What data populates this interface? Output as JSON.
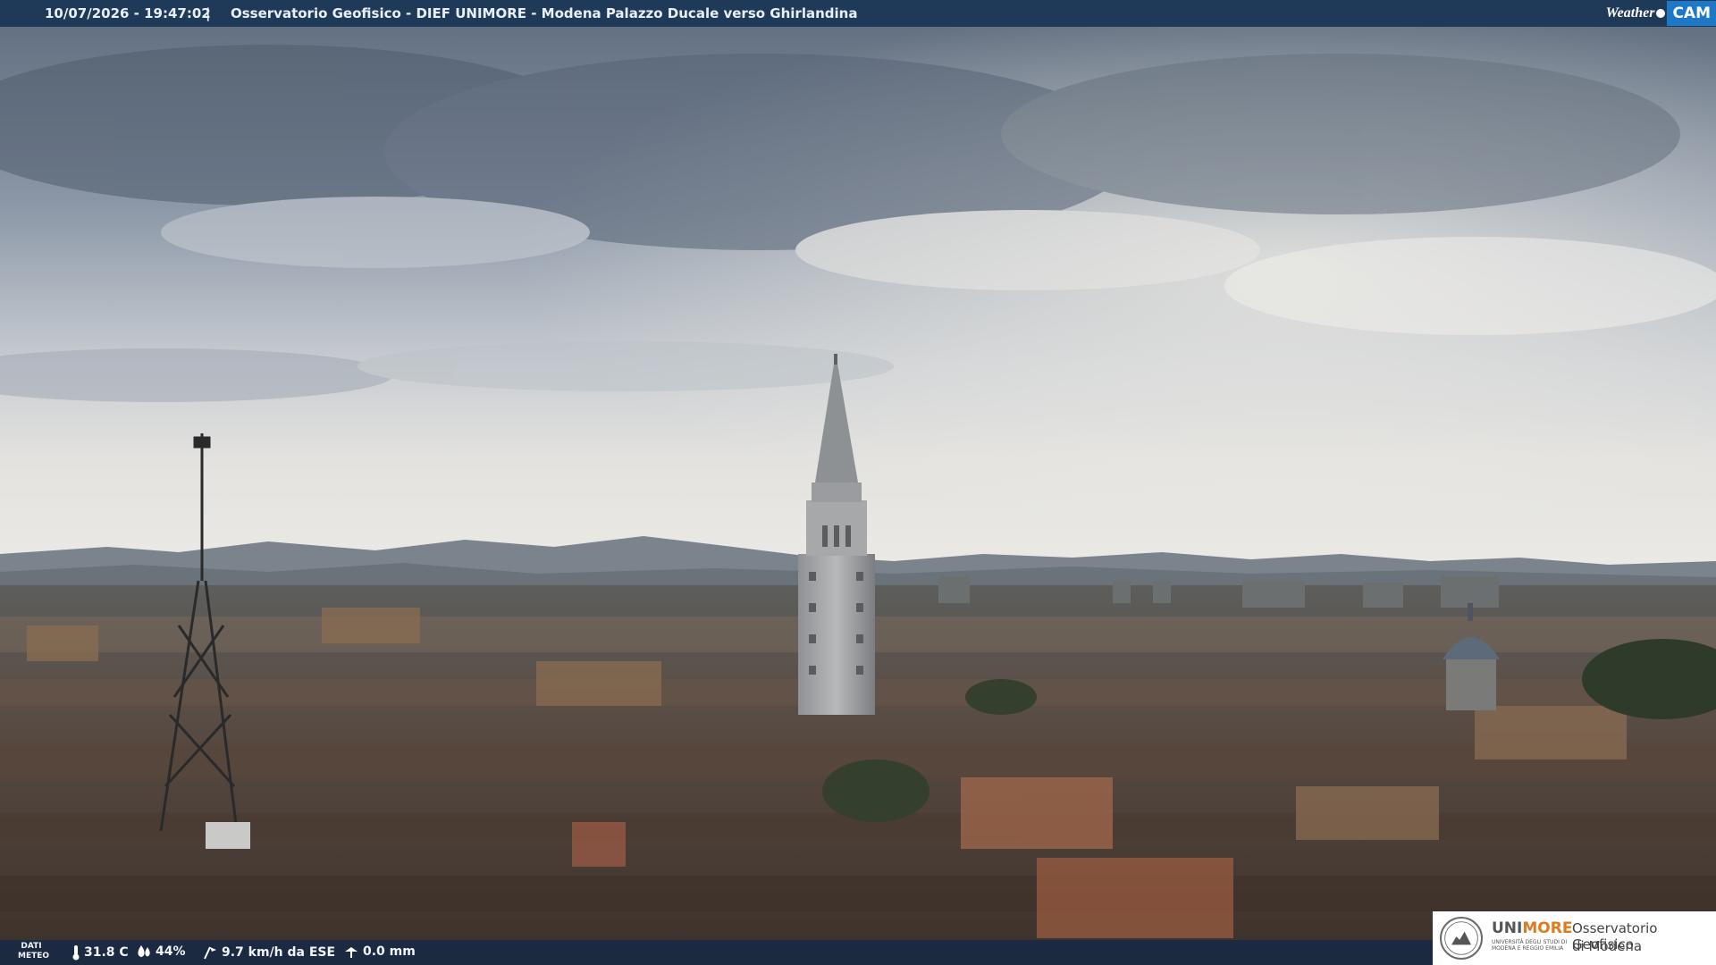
{
  "overlay": {
    "timestamp": "10/07/2026 - 19:47:02",
    "separator": "|",
    "camera_title": "Osservatorio Geofisico - DIEF UNIMORE - Modena Palazzo Ducale verso Ghirlandina",
    "brand_weather": "Weather",
    "brand_cam": "CAM"
  },
  "meteo": {
    "label_line1": "DATI",
    "label_line2": "METEO",
    "temperature": "31.8 C",
    "humidity": "44%",
    "wind": "9.7 km/h da ESE",
    "rain": "0.0 mm"
  },
  "logo": {
    "uni": "UNI",
    "more": "MORE",
    "sub": "UNIVERSITÀ DEGLI STUDI DI MODENA E REGGIO EMILIA",
    "title_line1": "Osservatorio Geofisico",
    "title_line2": "di Modena"
  },
  "colors": {
    "top_bar": "#1f3a58",
    "brand_blue": "#1e78c8",
    "unimore_orange": "#e07a1e"
  }
}
